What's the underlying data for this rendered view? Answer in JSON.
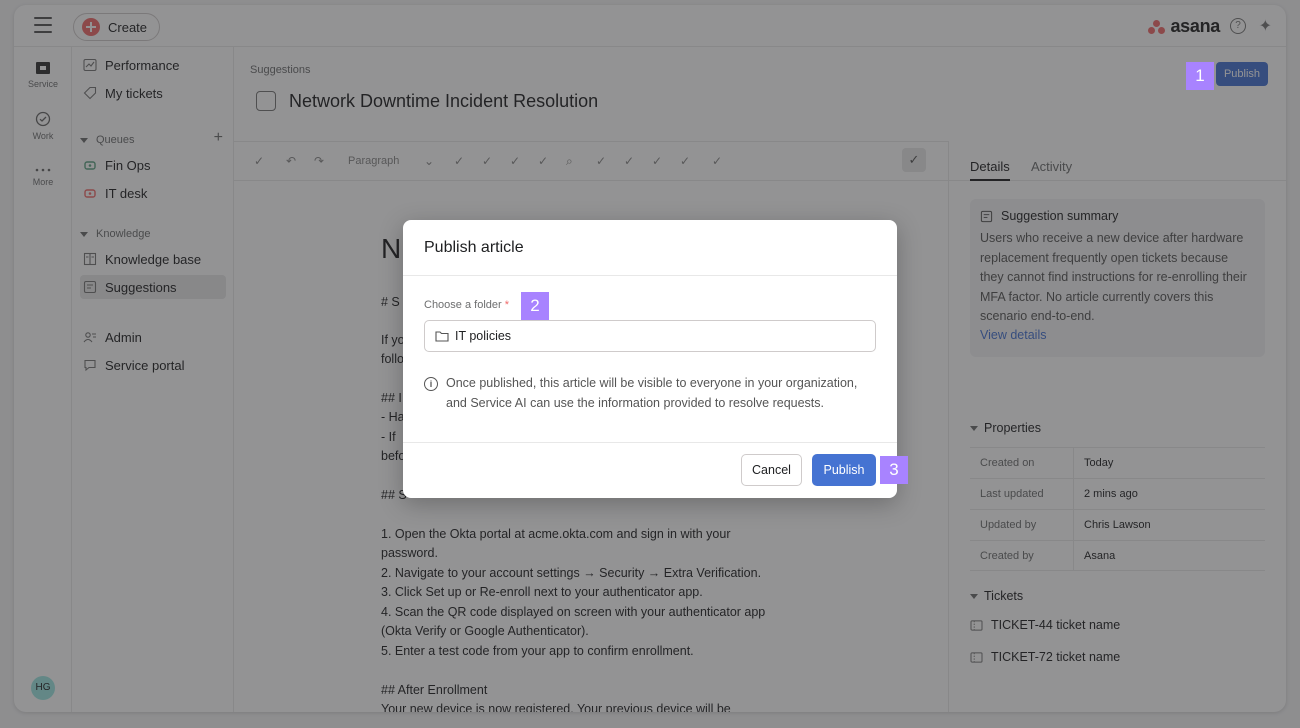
{
  "topbar": {
    "create_label": "Create",
    "brand": "asana",
    "help": "?",
    "ai": "✦"
  },
  "rail": [
    {
      "label": "Service"
    },
    {
      "label": "Work"
    },
    {
      "label": "More"
    }
  ],
  "avatar": "HG",
  "sidebar": {
    "performance": "Performance",
    "my_tickets": "My tickets",
    "queues_heading": "Queues",
    "fin_ops": "Fin Ops",
    "it_desk": "IT desk",
    "knowledge_heading": "Knowledge",
    "knowledge_base": "Knowledge base",
    "suggestions": "Suggestions",
    "admin": "Admin",
    "service_portal": "Service portal"
  },
  "main": {
    "breadcrumb": "Suggestions",
    "title": "Network Downtime Incident Resolution",
    "publish_label": "Publish",
    "toolbar_paragraph": "Paragraph"
  },
  "doc": {
    "big": "N",
    "lines": [
      "# S",
      "If yo",
      "follo",
      "## I",
      "- Ha",
      "- If",
      "befo",
      "## S",
      "1. Open the Okta portal at acme.okta.com and sign in with your",
      "password.",
      "2. Navigate to your account settings → Security → Extra Verification.",
      "3. Click Set up or Re-enroll next to your authenticator app.",
      "4. Scan the QR code displayed on screen with your authenticator app",
      "(Okta Verify or Google Authenticator).",
      "5. Enter a test code from your app to confirm enrollment.",
      "## After Enrollment",
      "Your new device is now registered. Your previous device will be"
    ]
  },
  "right": {
    "tab_details": "Details",
    "tab_activity": "Activity",
    "summary_title": "Suggestion summary",
    "summary_body": "Users who receive a new device after hardware replacement frequently open tickets because they cannot find instructions for re-enrolling their MFA factor. No article currently covers this scenario end-to-end.",
    "summary_link": "View details",
    "properties_title": "Properties",
    "properties": [
      {
        "k": "Created on",
        "v": "Today"
      },
      {
        "k": "Last updated",
        "v": "2 mins ago"
      },
      {
        "k": "Updated by",
        "v": "Chris Lawson"
      },
      {
        "k": "Created by",
        "v": "Asana"
      }
    ],
    "tickets_title": "Tickets",
    "tickets": [
      "TICKET-44 ticket name",
      "TICKET-72 ticket name"
    ]
  },
  "modal": {
    "title": "Publish article",
    "folder_label": "Choose a folder",
    "required_mark": "*",
    "folder_value": "IT policies",
    "info": "Once published, this article will be visible to everyone in your organization, and Service AI can use the information provided to resolve requests.",
    "cancel": "Cancel",
    "publish": "Publish"
  },
  "badges": [
    "1",
    "2",
    "3"
  ],
  "colors": {
    "accent": "#4573d2",
    "brand": "#f06a6a",
    "badge": "#a883ff"
  }
}
